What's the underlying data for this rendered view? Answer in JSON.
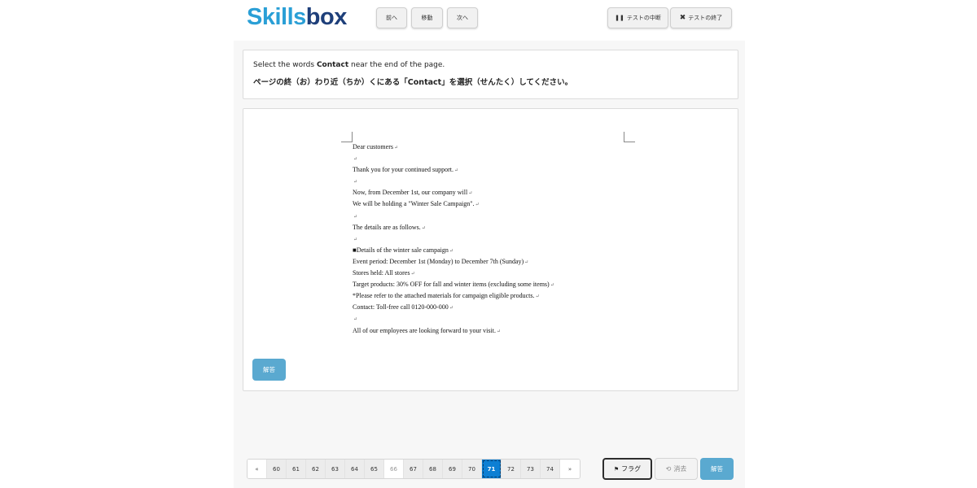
{
  "header": {
    "logo_part1": "Skills",
    "logo_part2": "box",
    "nav_buttons": {
      "prev": "前へ",
      "move": "移動",
      "next": "次へ"
    },
    "pause_label": "テストの中断",
    "end_label": "テストの終了"
  },
  "question": {
    "line1_prefix": "Select the words ",
    "line1_keyword": "Contact",
    "line1_suffix": " near the end of the page.",
    "line2": "ページの終（お）わり近（ちか）くにある「Contact」を選択（せんたく）してください。"
  },
  "document": {
    "lines": [
      "Dear customers",
      "",
      "Thank you for your continued support.",
      "",
      "Now, from December 1st, our company will",
      "We will be holding a \"Winter Sale Campaign\".",
      "",
      "The details are as follows.",
      "",
      "■Details of the winter sale campaign",
      "Event period: December 1st (Monday) to December 7th (Sunday)",
      "Stores held: All stores",
      "Target products: 30% OFF for fall and winter items (excluding some items)",
      "*Please refer to the attached materials for campaign eligible products.",
      "Contact: Toll-free call 0120-000-000",
      "",
      "All of our employees are looking forward to your visit."
    ],
    "paragraph_mark": "↵",
    "answer_label": "解答"
  },
  "pagination": {
    "first": "«",
    "last": "»",
    "pages": [
      "60",
      "61",
      "62",
      "63",
      "64",
      "65",
      "66",
      "67",
      "68",
      "69",
      "70",
      "71",
      "72",
      "73",
      "74"
    ],
    "current": "71"
  },
  "footer": {
    "flag_label": "フラグ",
    "clear_label": "消去",
    "answer_label": "解答"
  },
  "colors": {
    "brand_light": "#2a9fd6",
    "brand_dark": "#1e3f7a",
    "answer_button": "#5aa9d0",
    "active_page": "#0d7fd3"
  }
}
